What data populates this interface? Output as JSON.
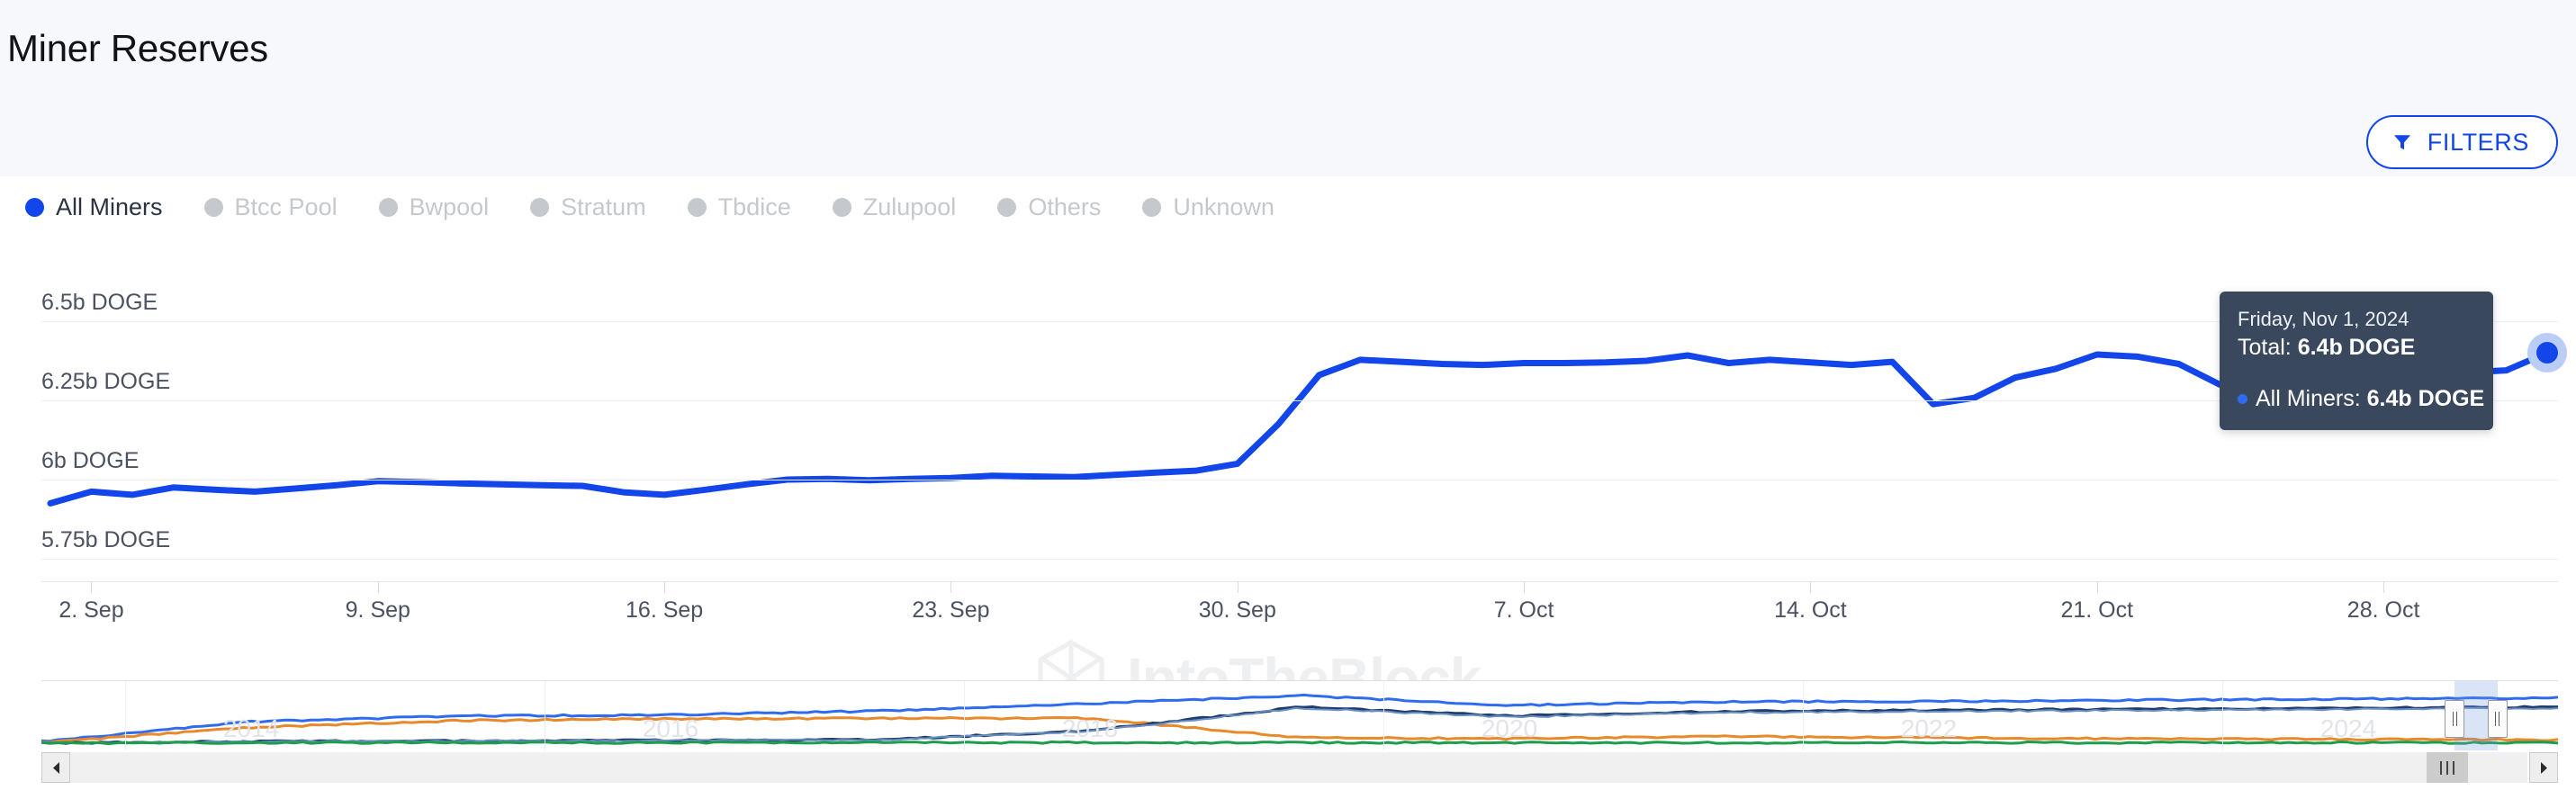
{
  "header": {
    "title": "Miner Reserves",
    "filters_label": "FILTERS",
    "filters_icon": "funnel-icon",
    "accent_color": "#1245ea",
    "band_color": "#f6f8fb"
  },
  "legend": {
    "items": [
      {
        "label": "All Miners",
        "active": true,
        "color": "#1245ea"
      },
      {
        "label": "Btcc Pool",
        "active": false,
        "color": "#c5c8cc"
      },
      {
        "label": "Bwpool",
        "active": false,
        "color": "#c5c8cc"
      },
      {
        "label": "Stratum",
        "active": false,
        "color": "#c5c8cc"
      },
      {
        "label": "Tbdice",
        "active": false,
        "color": "#c5c8cc"
      },
      {
        "label": "Zulupool",
        "active": false,
        "color": "#c5c8cc"
      },
      {
        "label": "Others",
        "active": false,
        "color": "#c5c8cc"
      },
      {
        "label": "Unknown",
        "active": false,
        "color": "#c5c8cc"
      }
    ]
  },
  "watermark": {
    "text": "IntoTheBlock",
    "logo": "intotheblock-logo-icon",
    "color": "#eeeff1"
  },
  "tooltip": {
    "date": "Friday, Nov 1, 2024",
    "total_prefix": "Total: ",
    "total_value": "6.4b DOGE",
    "series_name": "All Miners: ",
    "series_value": "6.4b DOGE",
    "bg_color": "#3a485e"
  },
  "navigator": {
    "years": [
      "2014",
      "2016",
      "2018",
      "2020",
      "2022",
      "2024"
    ],
    "selection_start_pct": 95.9,
    "selection_end_pct": 97.6,
    "scroll_left_icon": "caret-left-icon",
    "scroll_right_icon": "caret-right-icon",
    "thumb_grip_icon": "grip-icon",
    "series_colors": [
      "#2f6bf0",
      "#e8892b",
      "#1f3d6b",
      "#1f9d4f",
      "#6a8fc4"
    ]
  },
  "chart_data": {
    "type": "line",
    "title": "Miner Reserves",
    "xlabel": "",
    "ylabel": "DOGE",
    "unit": "DOGE",
    "ylim": [
      5.7,
      6.58
    ],
    "ytick_labels": [
      "6.5b DOGE",
      "6.25b DOGE",
      "6b DOGE",
      "5.75b DOGE"
    ],
    "ytick_values": [
      6.5,
      6.25,
      6.0,
      5.75
    ],
    "xtick_labels": [
      "2. Sep",
      "9. Sep",
      "16. Sep",
      "23. Sep",
      "30. Sep",
      "7. Oct",
      "14. Oct",
      "21. Oct",
      "28. Oct"
    ],
    "grid": true,
    "legend_position": "top-left",
    "series": [
      {
        "name": "All Miners",
        "color": "#1245ea",
        "x": [
          "1. Sep",
          "2. Sep",
          "3. Sep",
          "4. Sep",
          "5. Sep",
          "6. Sep",
          "7. Sep",
          "8. Sep",
          "9. Sep",
          "10. Sep",
          "11. Sep",
          "12. Sep",
          "13. Sep",
          "14. Sep",
          "15. Sep",
          "16. Sep",
          "17. Sep",
          "18. Sep",
          "19. Sep",
          "20. Sep",
          "21. Sep",
          "22. Sep",
          "23. Sep",
          "24. Sep",
          "25. Sep",
          "26. Sep",
          "27. Sep",
          "28. Sep",
          "29. Sep",
          "30. Sep",
          "1. Oct",
          "2. Oct",
          "3. Oct",
          "4. Oct",
          "5. Oct",
          "6. Oct",
          "7. Oct",
          "8. Oct",
          "9. Oct",
          "10. Oct",
          "11. Oct",
          "12. Oct",
          "13. Oct",
          "14. Oct",
          "15. Oct",
          "16. Oct",
          "17. Oct",
          "18. Oct",
          "19. Oct",
          "20. Oct",
          "21. Oct",
          "22. Oct",
          "23. Oct",
          "24. Oct",
          "25. Oct",
          "26. Oct",
          "27. Oct",
          "28. Oct",
          "29. Oct",
          "30. Oct",
          "31. Oct",
          "1. Nov"
        ],
        "values": [
          5.925,
          5.962,
          5.952,
          5.975,
          5.968,
          5.962,
          5.972,
          5.982,
          5.995,
          5.992,
          5.988,
          5.985,
          5.982,
          5.98,
          5.96,
          5.952,
          5.968,
          5.985,
          6.0,
          6.002,
          5.998,
          6.002,
          6.005,
          6.012,
          6.01,
          6.008,
          6.015,
          6.022,
          6.028,
          6.05,
          6.175,
          6.33,
          6.378,
          6.372,
          6.365,
          6.362,
          6.368,
          6.368,
          6.37,
          6.375,
          6.392,
          6.368,
          6.378,
          6.37,
          6.362,
          6.372,
          6.238,
          6.258,
          6.322,
          6.35,
          6.395,
          6.388,
          6.365,
          6.3,
          6.288,
          6.292,
          6.318,
          6.318,
          6.33,
          6.338,
          6.345,
          6.4
        ]
      }
    ],
    "endpoint": {
      "label": "6.4b DOGE",
      "date": "Friday, Nov 1, 2024",
      "value": 6.4
    }
  }
}
